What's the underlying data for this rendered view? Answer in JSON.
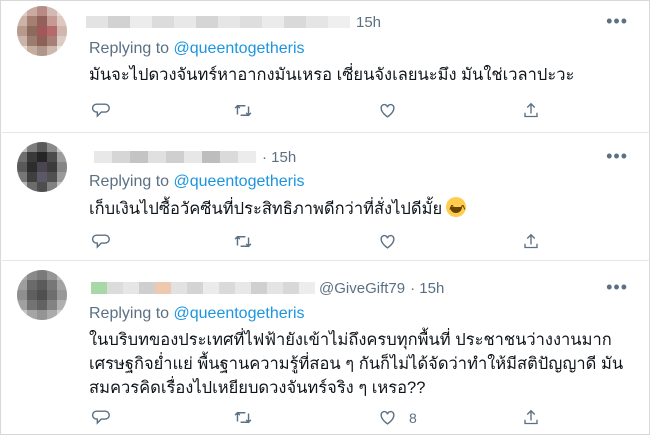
{
  "tweets": [
    {
      "handle": "",
      "time": "15h",
      "replying_label": "Replying to",
      "mention": "@queentogetheris",
      "lines": [
        "มันจะไปดวงจันทร์หาอากงมันเหรอ เซี่ยนจังเลยนะมึง มันใช่เวลาปะวะ"
      ],
      "emoji": "",
      "actions": {
        "reply_icon": "reply-icon",
        "retweet_icon": "retweet-icon",
        "like_icon": "heart-icon",
        "like_count": "",
        "share_icon": "share-icon"
      }
    },
    {
      "handle": "",
      "time": "· 15h",
      "replying_label": "Replying to",
      "mention": "@queentogetheris",
      "lines": [
        "เก็บเงินไปซื้อวัคซีนที่ประสิทธิภาพดีกว่าที่สั่งไปดีมั้ย"
      ],
      "emoji": "grinning-squinting-face",
      "actions": {
        "reply_icon": "reply-icon",
        "retweet_icon": "retweet-icon",
        "like_icon": "heart-icon",
        "like_count": "",
        "share_icon": "share-icon"
      }
    },
    {
      "handle": "@GiveGift79",
      "time": "· 15h",
      "replying_label": "Replying to",
      "mention": "@queentogetheris",
      "lines": [
        "ในบริบทของประเทศที่ไฟฟ้ายังเข้าไม่ถึงครบทุกพื้นที่ ประชาชนว่างงานมาก",
        "เศรษฐกิจย่ำแย่ พื้นฐานความรู้ที่สอน ๆ กันก็ไม่ได้จัดว่าทำให้มีสติปัญญาดี มัน",
        "สมควรคิดเรื่องไปเหยียบดวงจันทร์จริง ๆ เหรอ??"
      ],
      "emoji": "",
      "actions": {
        "reply_icon": "reply-icon",
        "retweet_icon": "retweet-icon",
        "like_icon": "heart-icon",
        "like_count": "8",
        "share_icon": "share-icon"
      }
    }
  ],
  "colors": {
    "mention": "#1b95e0",
    "secondary": "#5b7083",
    "text": "#0f1419",
    "divider": "#e1e8ed"
  }
}
